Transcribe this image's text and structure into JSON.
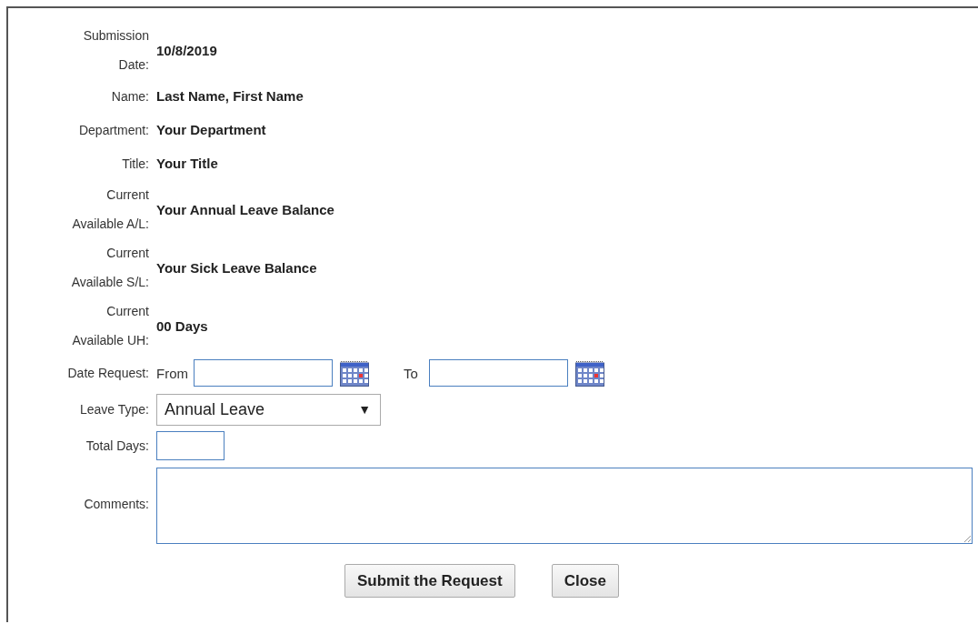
{
  "info_fields": [
    {
      "label": "Submission Date:",
      "value": "10/8/2019"
    },
    {
      "label": "Name:",
      "value": "Last Name, First Name"
    },
    {
      "label": "Department:",
      "value": "Your Department"
    },
    {
      "label": "Title:",
      "value": "Your Title"
    },
    {
      "label": "Current Available A/L:",
      "value": "Your Annual Leave Balance"
    },
    {
      "label": "Current Available S/L:",
      "value": "Your Sick Leave Balance"
    },
    {
      "label": "Current Available UH:",
      "value": "00 Days"
    }
  ],
  "date_request": {
    "label": "Date Request:",
    "from_label": "From",
    "to_label": "To"
  },
  "leave_type": {
    "label": "Leave Type:",
    "value": "Annual Leave",
    "arrow": "▼"
  },
  "total_days": {
    "label": "Total Days:"
  },
  "comments": {
    "label": "Comments:"
  },
  "buttons": [
    {
      "label": "Submit the Request"
    },
    {
      "label": "Close"
    }
  ]
}
